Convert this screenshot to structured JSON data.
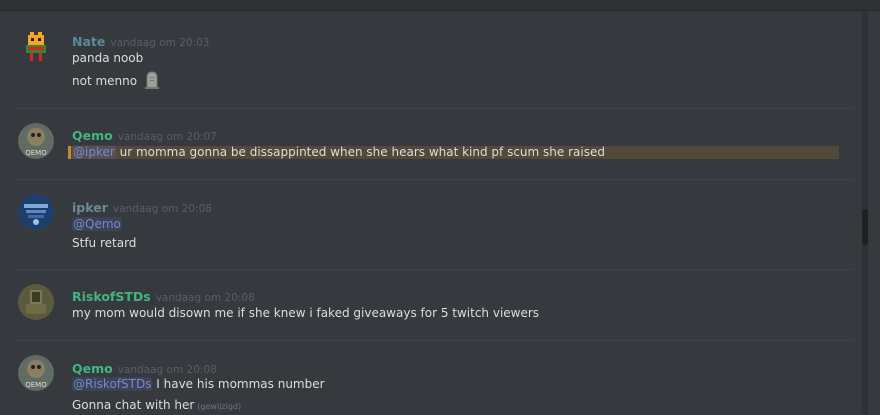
{
  "colors": {
    "background": "#36393e",
    "mention": "#7289da",
    "nate": "#5a8a9a",
    "qemo": "#43b581",
    "ipker": "#6a8a95",
    "risk": "#43b581"
  },
  "messages": [
    {
      "author": "Nate",
      "timestamp": "vandaag om 20:03",
      "avatar_icon": "pixel-character-avatar",
      "lines": [
        {
          "text": "panda noob"
        },
        {
          "text": "not menno",
          "emoji": "tombstone-emoji"
        }
      ]
    },
    {
      "author": "Qemo",
      "timestamp": "vandaag om 20:07",
      "avatar_icon": "qemo-avatar",
      "lines": [
        {
          "mention": "@ipker",
          "text": " ur momma gonna be dissappinted when she hears what kind pf scum she raised",
          "highlighted": true
        }
      ]
    },
    {
      "author": "ipker",
      "timestamp": "vandaag om 20:08",
      "avatar_icon": "ipker-avatar",
      "lines": [
        {
          "mention": "@Qemo"
        },
        {
          "text": "Stfu retard"
        }
      ]
    },
    {
      "author": "RiskofSTDs",
      "timestamp": "vandaag om 20:08",
      "avatar_icon": "riskofstds-avatar",
      "lines": [
        {
          "text": "my mom would disown me if she knew i faked giveaways for 5 twitch viewers"
        }
      ]
    },
    {
      "author": "Qemo",
      "timestamp": "vandaag om 20:08",
      "avatar_icon": "qemo-avatar",
      "lines": [
        {
          "mention": "@RiskofSTDs",
          "text": " I have his mommas number"
        },
        {
          "text": "Gonna chat with her",
          "edited": "(gewijzigd)"
        }
      ]
    }
  ]
}
